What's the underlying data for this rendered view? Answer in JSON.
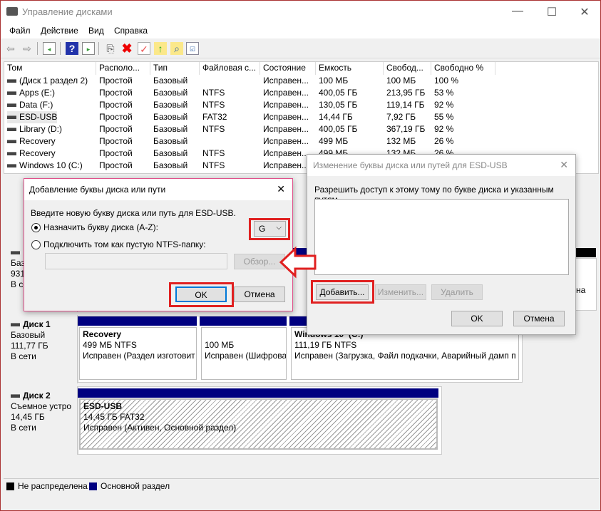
{
  "window": {
    "title": "Управление дисками",
    "minimize": "—",
    "maximize": "☐",
    "close": "✕"
  },
  "menu": [
    "Файл",
    "Действие",
    "Вид",
    "Справка"
  ],
  "toolbar": [
    "back-icon",
    "forward-icon",
    "console-tree-icon",
    "help-icon",
    "action-pane-icon",
    "connect-icon",
    "delete-icon",
    "properties-icon",
    "folder-up-icon",
    "folder-search-icon",
    "checklist-icon"
  ],
  "volumes": {
    "headers": [
      "Том",
      "Располо...",
      "Тип",
      "Файловая с...",
      "Состояние",
      "Емкость",
      "Свобод...",
      "Свободно %"
    ],
    "rows": [
      [
        "(Диск 1 раздел 2)",
        "Простой",
        "Базовый",
        "",
        "Исправен...",
        "100 МБ",
        "100 МБ",
        "100 %"
      ],
      [
        "Apps (E:)",
        "Простой",
        "Базовый",
        "NTFS",
        "Исправен...",
        "400,05 ГБ",
        "213,95 ГБ",
        "53 %"
      ],
      [
        "Data (F:)",
        "Простой",
        "Базовый",
        "NTFS",
        "Исправен...",
        "130,05 ГБ",
        "119,14 ГБ",
        "92 %"
      ],
      [
        "ESD-USB",
        "Простой",
        "Базовый",
        "FAT32",
        "Исправен...",
        "14,44 ГБ",
        "7,92 ГБ",
        "55 %"
      ],
      [
        "Library (D:)",
        "Простой",
        "Базовый",
        "NTFS",
        "Исправен...",
        "400,05 ГБ",
        "367,19 ГБ",
        "92 %"
      ],
      [
        "Recovery",
        "Простой",
        "Базовый",
        "",
        "Исправен...",
        "499 МБ",
        "132 МБ",
        "26 %"
      ],
      [
        "Recovery",
        "Простой",
        "Базовый",
        "NTFS",
        "Исправен...",
        "499 МБ",
        "132 МБ",
        "26 %"
      ],
      [
        "Windows 10 (C:)",
        "Простой",
        "Базовый",
        "NTFS",
        "Исправен...",
        "",
        "",
        ""
      ]
    ]
  },
  "disk0": {
    "type": "Баз",
    "size": "931,",
    "status": "В се",
    "right_text": "на"
  },
  "disk1": {
    "name": "Диск 1",
    "type": "Базовый",
    "size": "111,77 ГБ",
    "status": "В сети",
    "partitions": [
      {
        "name": "Recovery",
        "size": "499 МБ NTFS",
        "status": "Исправен (Раздел изготовит"
      },
      {
        "name": "",
        "size": "100 МБ",
        "status": "Исправен (Шифрова"
      },
      {
        "name": "Windows 10  (C:)",
        "size": "111,19 ГБ NTFS",
        "status": "Исправен (Загрузка, Файл подкачки, Аварийный дамп п"
      }
    ]
  },
  "disk2": {
    "name": "Диск 2",
    "type": "Съемное устро",
    "size": "14,45 ГБ",
    "status": "В сети",
    "partition": {
      "name": "ESD-USB",
      "size": "14,45 ГБ FAT32",
      "status": "Исправен (Активен, Основной раздел)"
    }
  },
  "legend": {
    "unallocated": "Не распределена",
    "primary": "Основной раздел",
    "colors": {
      "unallocated": "#000000",
      "primary": "#000080"
    }
  },
  "add_dialog": {
    "title": "Добавление буквы диска или пути",
    "prompt": "Введите новую букву диска или путь для ESD-USB.",
    "assign_label": "Назначить букву диска (A-Z):",
    "letter": "G",
    "mount_label": "Подключить том как пустую NTFS-папку:",
    "path_value": "",
    "browse": "Обзор...",
    "ok": "OK",
    "cancel": "Отмена",
    "close": "✕"
  },
  "change_dialog": {
    "title": "Изменение буквы диска или путей для ESD-USB",
    "prompt": "Разрешить доступ к этому тому по букве диска и указанным путям.",
    "add": "Добавить...",
    "change": "Изменить...",
    "remove": "Удалить",
    "ok": "OK",
    "cancel": "Отмена",
    "close": "✕"
  },
  "highlight_color": "#e02020"
}
